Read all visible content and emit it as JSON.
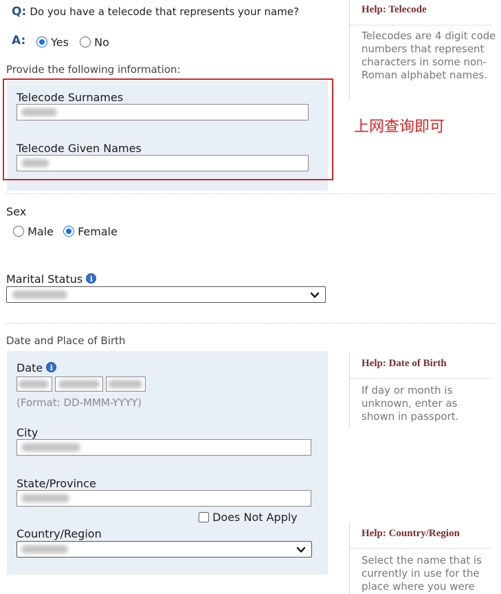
{
  "telecode": {
    "q_letter": "Q:",
    "question": "Do you have a telecode that represents your name?",
    "a_letter": "A:",
    "yes_label": "Yes",
    "no_label": "No",
    "selected": "Yes",
    "provide_text": "Provide the following information:",
    "surnames_label": "Telecode Surnames",
    "given_names_label": "Telecode Given Names",
    "annotation": "上网查询即可",
    "help": {
      "title_prefix": "Help:",
      "title": "Telecode",
      "text": "Telecodes are 4 digit code numbers that represent characters in some non-Roman alphabet names."
    }
  },
  "sex": {
    "label": "Sex",
    "male_label": "Male",
    "female_label": "Female",
    "selected": "Female"
  },
  "marital": {
    "label": "Marital Status",
    "info_icon": "i"
  },
  "birth": {
    "section_title": "Date and Place of Birth",
    "date_label": "Date",
    "info_icon": "i",
    "format_hint": "(Format: DD-MMM-YYYY)",
    "city_label": "City",
    "state_label": "State/Province",
    "does_not_apply_label": "Does Not Apply",
    "country_label": "Country/Region",
    "help_dob": {
      "title_prefix": "Help:",
      "title": "Date of Birth",
      "text": "If day or month is unknown, enter as shown in passport."
    },
    "help_country": {
      "title_prefix": "Help:",
      "title": "Country/Region",
      "text": "Select the name that is currently in use for the place where you were"
    }
  },
  "colors": {
    "accent_blue": "#1a73e8",
    "panel_bg": "#e9eff6",
    "annotation_red": "#e02020",
    "help_title": "#7a2c2c"
  }
}
